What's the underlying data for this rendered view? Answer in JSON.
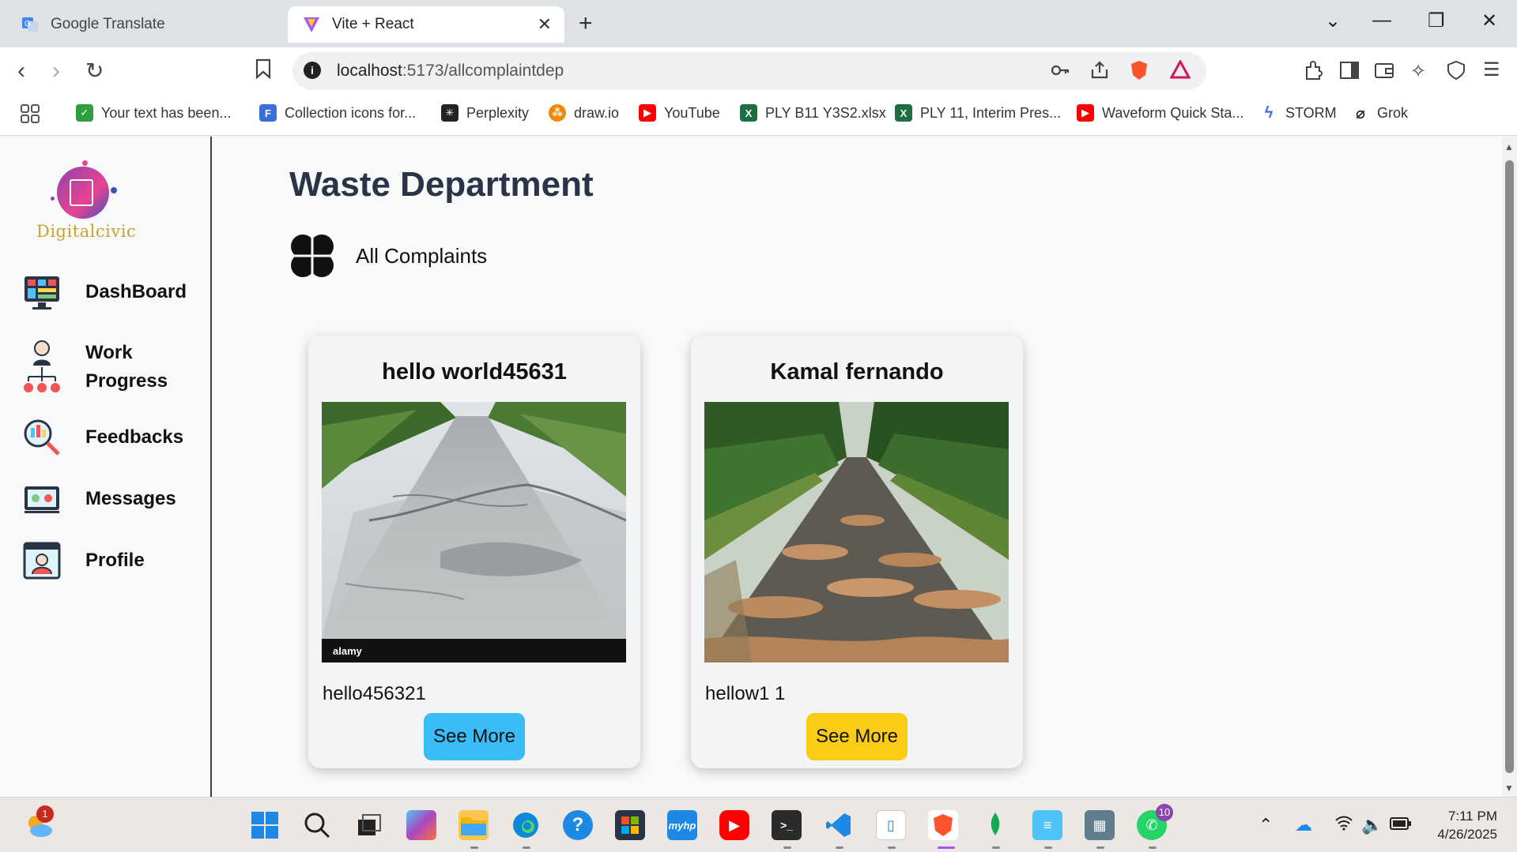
{
  "browser": {
    "tabs": [
      {
        "label": "Google Translate",
        "active": false
      },
      {
        "label": "Vite + React",
        "active": true
      }
    ],
    "url_host": "localhost",
    "url_path": ":5173/allcomplaintdep",
    "bookmarks": [
      {
        "label": "Your text has been...",
        "icon": "check-icon",
        "color": "#2e9e3e"
      },
      {
        "label": "Collection icons for...",
        "icon": "flaticon-icon",
        "color": "#3b6fd8"
      },
      {
        "label": "Perplexity",
        "icon": "perplexity-icon",
        "color": "#222222"
      },
      {
        "label": "draw.io",
        "icon": "drawio-icon",
        "color": "#f08705"
      },
      {
        "label": "YouTube",
        "icon": "youtube-icon",
        "color": "#ff0000"
      },
      {
        "label": "PLY B11 Y3S2.xlsx",
        "icon": "excel-icon",
        "color": "#1d6f42"
      },
      {
        "label": "PLY 11, Interim Pres...",
        "icon": "excel-icon",
        "color": "#1d6f42"
      },
      {
        "label": "Waveform Quick Sta...",
        "icon": "youtube-icon",
        "color": "#ff0000"
      },
      {
        "label": "STORM",
        "icon": "storm-icon",
        "color": "#3b6fd8"
      },
      {
        "label": "Grok",
        "icon": "grok-icon",
        "color": "#222222"
      }
    ]
  },
  "app": {
    "logo_text": "Digitalcivic",
    "nav": [
      {
        "label": "DashBoard",
        "icon": "dashboard-icon"
      },
      {
        "label": "Work Progress",
        "icon": "work-progress-icon"
      },
      {
        "label": "Feedbacks",
        "icon": "feedback-icon"
      },
      {
        "label": "Messages",
        "icon": "messages-icon"
      },
      {
        "label": "Profile",
        "icon": "profile-icon"
      }
    ],
    "page_title": "Waste Department",
    "section_label": "All Complaints",
    "complaints": [
      {
        "title": "hello world45631",
        "description": "hello456321",
        "button": "See More",
        "button_color": "#38bdf8",
        "image": "cracked-road-photo",
        "watermark": "alamy"
      },
      {
        "title": "Kamal fernando",
        "description": "hellow1 1",
        "button": "See More",
        "button_color": "#facc15",
        "image": "pothole-road-photo"
      }
    ]
  },
  "taskbar": {
    "weather_badge": "1",
    "whatsapp_badge": "10",
    "time": "7:11 PM",
    "date": "4/26/2025"
  }
}
